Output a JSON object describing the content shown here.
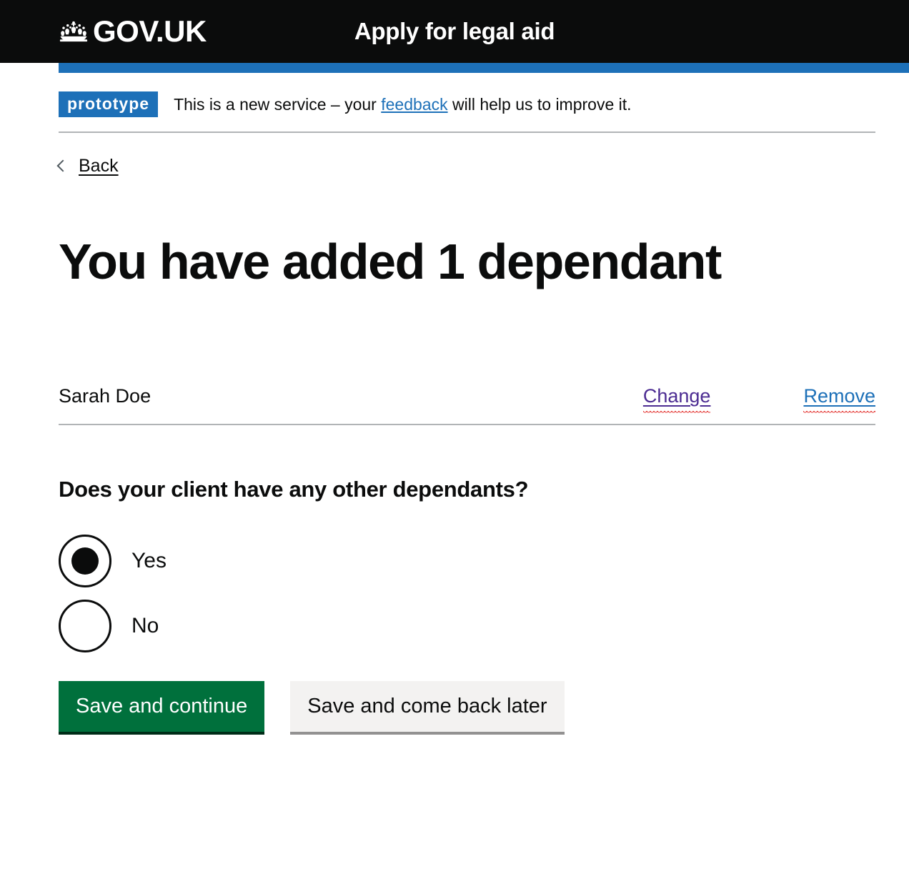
{
  "header": {
    "logo_text": "GOV.UK",
    "crown_icon": "crown-icon",
    "service_name": "Apply for legal aid"
  },
  "phase_banner": {
    "tag": "prototype",
    "text_before": "This is a new service – your ",
    "link": "feedback",
    "text_after": " will help us to improve it."
  },
  "back": {
    "label": "Back",
    "icon": "chevron-left-icon"
  },
  "main": {
    "heading": "You have added 1 dependant",
    "summary": {
      "rows": [
        {
          "name": "Sarah Doe",
          "change_label": "Change",
          "remove_label": "Remove"
        }
      ]
    },
    "question": {
      "legend": "Does your client have any other dependants?",
      "options": [
        {
          "label": "Yes",
          "checked": true
        },
        {
          "label": "No",
          "checked": false
        }
      ]
    },
    "buttons": {
      "primary": "Save and continue",
      "secondary": "Save and come back later"
    }
  },
  "colors": {
    "header_black": "#0b0c0c",
    "govuk_blue": "#1d70b8",
    "visited_purple": "#4c2c92",
    "button_green": "#00703c",
    "button_green_shadow": "#002d18",
    "button_grey": "#f3f2f1",
    "button_grey_shadow": "#929191",
    "border_grey": "#b1b4b6",
    "spellcheck_red": "#e53935"
  }
}
